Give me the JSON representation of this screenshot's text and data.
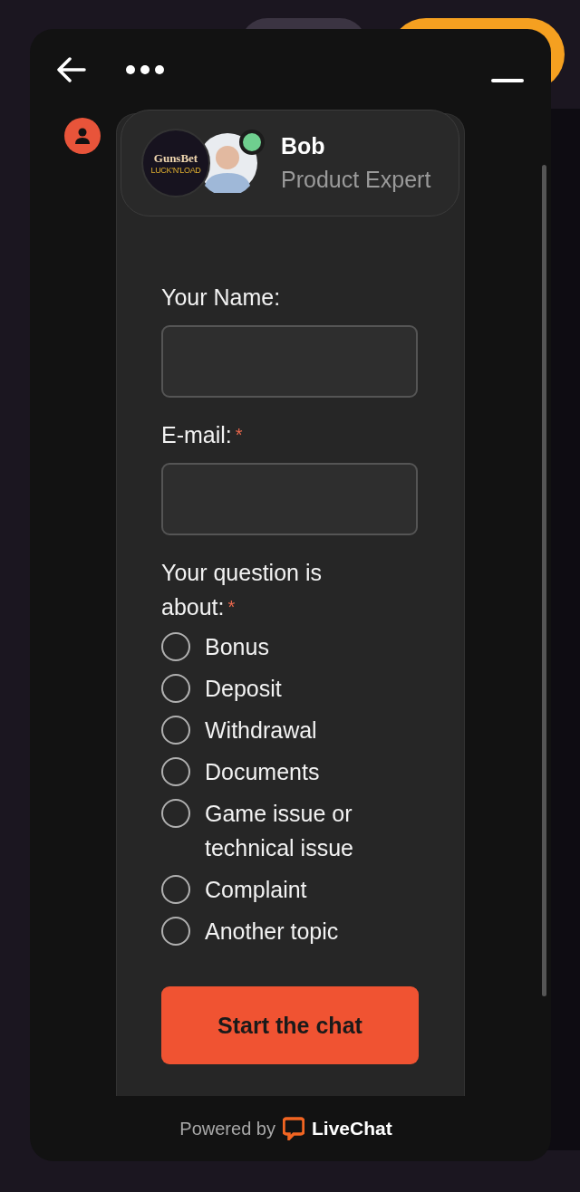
{
  "agent": {
    "name": "Bob",
    "role": "Product Expert",
    "online": true,
    "brand": {
      "name": "GunsBet",
      "tagline": "LUCK'N'LOAD"
    }
  },
  "form": {
    "required_mark": "*",
    "fields": [
      {
        "label": "Your Name:",
        "required": false
      },
      {
        "label": "E-mail:",
        "required": true
      }
    ],
    "question": {
      "label": "Your question is about:",
      "required": true,
      "options": [
        {
          "label": "Bonus",
          "selected": false
        },
        {
          "label": "Deposit",
          "selected": false
        },
        {
          "label": "Withdrawal",
          "selected": false
        },
        {
          "label": "Documents",
          "selected": false
        },
        {
          "label": "Game issue or technical issue",
          "selected": false
        },
        {
          "label": "Complaint",
          "selected": false
        },
        {
          "label": "Another topic",
          "selected": false
        }
      ]
    },
    "submit": "Start the chat"
  },
  "footer": {
    "prefix": "Powered by",
    "brand": "LiveChat"
  }
}
